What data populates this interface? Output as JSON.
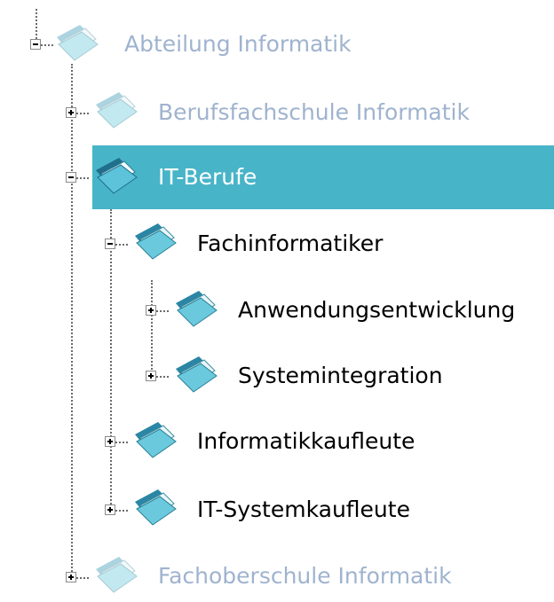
{
  "tree": {
    "root": {
      "label": "Abteilung Informatik",
      "state": "expanded",
      "icon": "folder-icon"
    },
    "berufsfachschule": {
      "label": "Berufsfachschule Informatik",
      "state": "collapsed",
      "icon": "folder-icon"
    },
    "it_berufe": {
      "label": "IT-Berufe",
      "state": "expanded",
      "selected": true,
      "icon": "folder-icon"
    },
    "fachinformatiker": {
      "label": "Fachinformatiker",
      "state": "expanded",
      "icon": "folder-icon"
    },
    "anwendungsentwicklung": {
      "label": "Anwendungsentwicklung",
      "state": "collapsed",
      "icon": "folder-icon"
    },
    "systemintegration": {
      "label": "Systemintegration",
      "state": "collapsed",
      "icon": "folder-icon"
    },
    "informatikkaufleute": {
      "label": "Informatikkaufleute",
      "state": "collapsed",
      "icon": "folder-icon"
    },
    "it_systemkaufleute": {
      "label": "IT-Systemkaufleute",
      "state": "collapsed",
      "icon": "folder-icon"
    },
    "fachoberschule": {
      "label": "Fachoberschule Informatik",
      "state": "collapsed",
      "icon": "folder-icon"
    }
  },
  "colors": {
    "selection_background": "#48b4c8",
    "muted_text": "#9fb3cf",
    "selected_text": "#ffffff",
    "normal_text": "#000000",
    "guide_line": "#6b6b6b"
  }
}
